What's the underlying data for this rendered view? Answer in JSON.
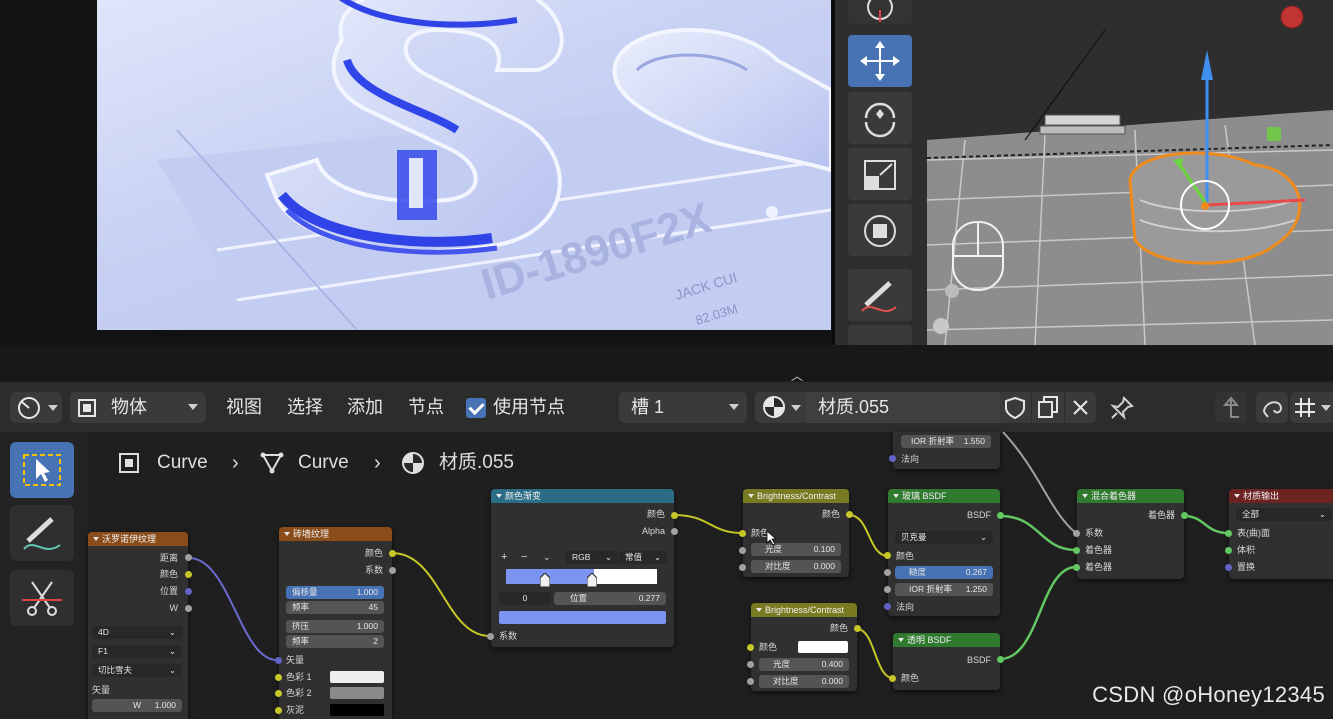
{
  "render_view": {
    "engraving_id": "ID-1890F2X",
    "engraving_name": "JACK CUI",
    "engraving_size": "82.03M"
  },
  "header": {
    "mode_label": "物体",
    "menus": [
      "视图",
      "选择",
      "添加",
      "节点"
    ],
    "use_nodes_label": "使用节点",
    "slot_label": "槽 1",
    "material_name": "材质.055"
  },
  "breadcrumb": [
    "Curve",
    "Curve",
    "材质.055"
  ],
  "nodes": {
    "voronoi": {
      "title": "沃罗诺伊纹理",
      "outputs": [
        "距离",
        "颜色",
        "位置",
        "W"
      ],
      "dropdowns": [
        "4D",
        "F1",
        "切比雪夫"
      ],
      "section": "矢量",
      "w_label": "W",
      "w_value": "1.000"
    },
    "brick": {
      "title": "砖墙纹理",
      "outputs": [
        "颜色",
        "系数"
      ],
      "fields": [
        {
          "label": "偏移量",
          "value": "1.000"
        },
        {
          "label": "频率",
          "value": "45"
        },
        {
          "label": "挤压",
          "value": "1.000"
        },
        {
          "label": "频率",
          "value": "2"
        }
      ],
      "inputs": [
        "矢量",
        "色彩 1",
        "色彩 2",
        "灰泥"
      ]
    },
    "colorramp": {
      "title": "颜色渐变",
      "outputs": [
        "颜色",
        "Alpha"
      ],
      "mode": "RGB",
      "interp": "常值",
      "index": "0",
      "pos_label": "位置",
      "pos_value": "0.277",
      "input": "系数",
      "ops": [
        "+",
        "−"
      ]
    },
    "ior_partial": {
      "field_label": "IOR 折射率",
      "field_value": "1.550",
      "input": "法向"
    },
    "bc1": {
      "title": "Brightness/Contrast",
      "output": "颜色",
      "input": "颜色",
      "fields": [
        {
          "label": "光度",
          "value": "0.100"
        },
        {
          "label": "对比度",
          "value": "0.000"
        }
      ]
    },
    "bc2": {
      "title": "Brightness/Contrast",
      "output": "颜色",
      "input": "颜色",
      "fields": [
        {
          "label": "光度",
          "value": "0.400"
        },
        {
          "label": "对比度",
          "value": "0.000"
        }
      ]
    },
    "glass": {
      "title": "玻璃 BSDF",
      "output": "BSDF",
      "dist": "贝克曼",
      "input_color": "颜色",
      "fields": [
        {
          "label": "糙度",
          "value": "0.267"
        },
        {
          "label": "IOR 折射率",
          "value": "1.250"
        }
      ],
      "input_normal": "法向"
    },
    "transparent": {
      "title": "透明 BSDF",
      "output": "BSDF",
      "input": "颜色"
    },
    "mix": {
      "title": "混合着色器",
      "output": "着色器",
      "inputs": [
        "系数",
        "着色器",
        "着色器"
      ]
    },
    "output": {
      "title": "材质输出",
      "target": "全部",
      "inputs": [
        "表(曲)面",
        "体积",
        "置换"
      ]
    }
  },
  "colors": {
    "accent": "#4772b3",
    "ramp_left": "#7b94f2",
    "ramp_right": "#ffffff"
  },
  "watermark": "CSDN @oHoney12345"
}
